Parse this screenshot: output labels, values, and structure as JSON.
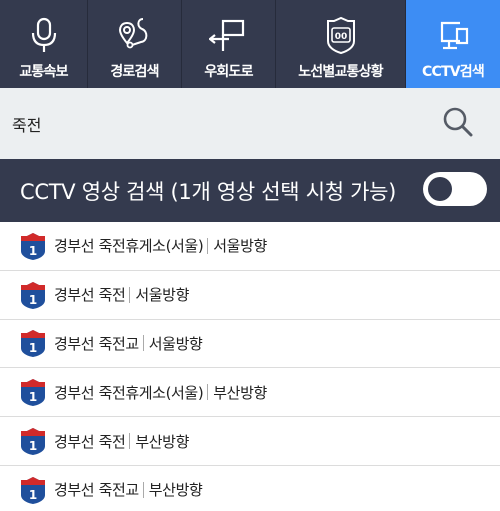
{
  "nav": {
    "items": [
      {
        "label": "교통속보",
        "icon": "microphone-icon",
        "active": false
      },
      {
        "label": "경로검색",
        "icon": "route-icon",
        "active": false
      },
      {
        "label": "우회도로",
        "icon": "detour-sign-icon",
        "active": false
      },
      {
        "label": "노선별교통상황",
        "icon": "route-shield-icon",
        "active": false
      },
      {
        "label": "CCTV검색",
        "icon": "cctv-monitor-icon",
        "active": true
      }
    ]
  },
  "search": {
    "value": "죽전",
    "placeholder": "",
    "button_icon": "search-icon"
  },
  "cctv": {
    "title": "CCTV 영상 검색 (1개 영상 선택 시청 가능)",
    "toggle_on": false
  },
  "results": [
    {
      "route_no": "1",
      "road": "경부선 죽전휴게소(서울)",
      "direction": "서울방향"
    },
    {
      "route_no": "1",
      "road": "경부선 죽전",
      "direction": "서울방향"
    },
    {
      "route_no": "1",
      "road": "경부선 죽전교",
      "direction": "서울방향"
    },
    {
      "route_no": "1",
      "road": "경부선 죽전휴게소(서울)",
      "direction": "부산방향"
    },
    {
      "route_no": "1",
      "road": "경부선 죽전",
      "direction": "부산방향"
    },
    {
      "route_no": "1",
      "road": "경부선 죽전교",
      "direction": "부산방향"
    }
  ],
  "colors": {
    "nav_bg": "#343a4e",
    "nav_active": "#3d8df4",
    "search_bg": "#eceff1",
    "shield_blue": "#1f4f9c",
    "shield_red": "#d12a2a"
  }
}
